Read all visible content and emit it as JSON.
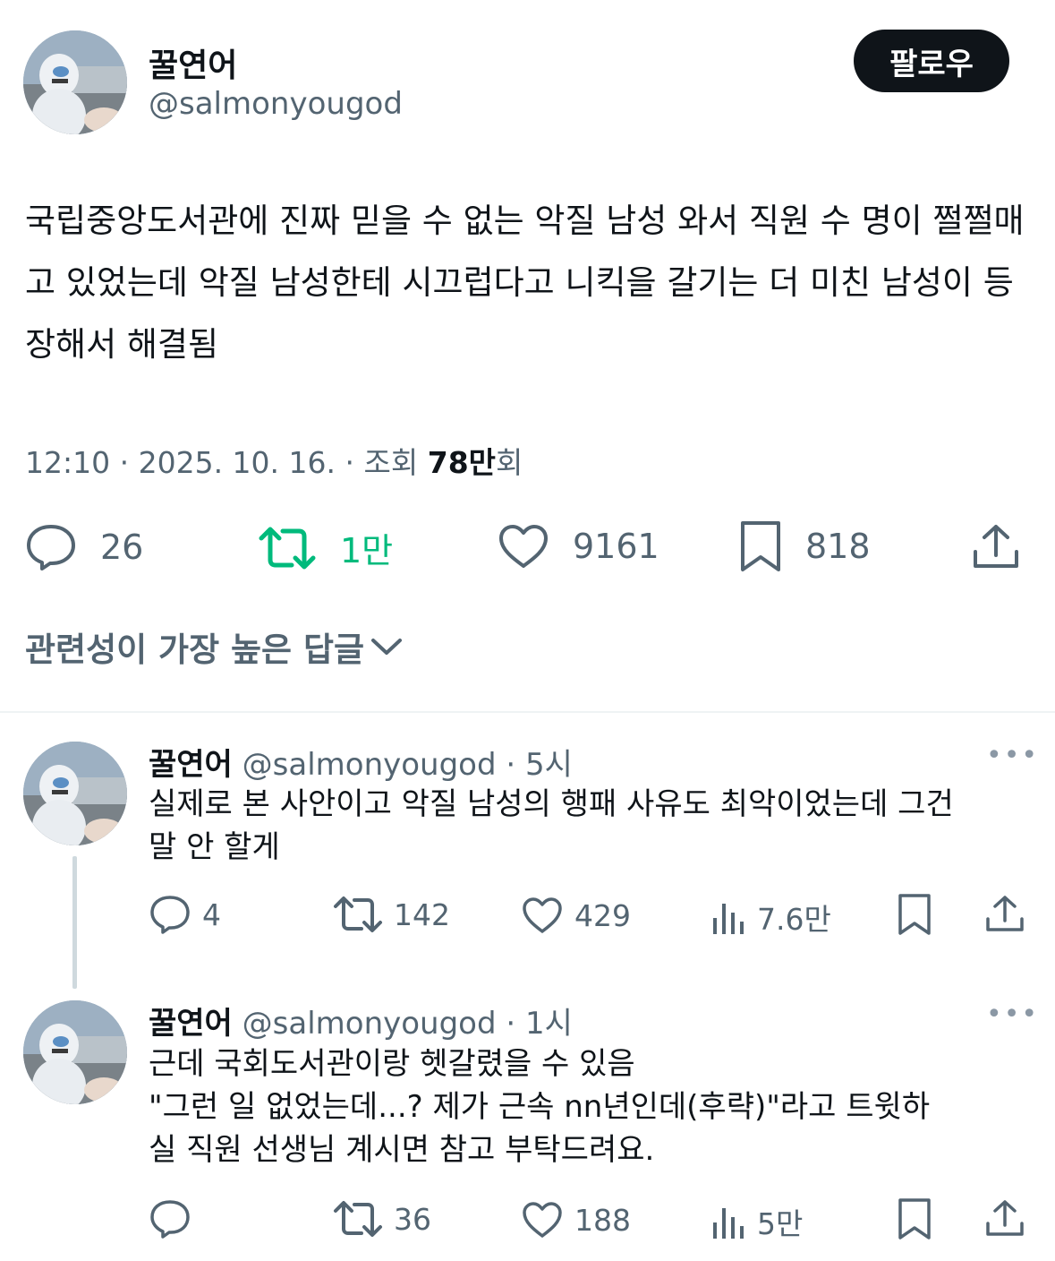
{
  "tweet": {
    "author_name": "꿀연어",
    "author_handle": "@salmonyougod",
    "follow_label": "팔로우",
    "text": "국립중앙도서관에 진짜 믿을 수 없는 악질 남성 와서 직원 수 명이 쩔쩔매고 있었는데 악질 남성한테 시끄럽다고 니킥을 갈기는 더 미친 남성이 등장해서 해결됨",
    "time": "12:10",
    "date": "2025. 10. 16.",
    "views_label": "조회",
    "views_count": "78만",
    "views_suffix": "회",
    "stats": {
      "replies": "26",
      "retweets": "1만",
      "likes": "9161",
      "bookmarks": "818"
    },
    "colors": {
      "retweet_active": "#00ba7c",
      "text": "#0f1419",
      "muted": "#536471"
    }
  },
  "replies_filter": {
    "label": "관련성이 가장 높은 답글",
    "icon": "chevron-down-icon"
  },
  "replies": [
    {
      "author_name": "꿀연어",
      "author_handle": "@salmonyougod",
      "time": "· 5시",
      "text_lines": [
        "실제로 본 사안이고 악질 남성의 행패 사유도 최악이었는데 그건",
        "말 안 할게"
      ],
      "stats": {
        "replies": "4",
        "retweets": "142",
        "likes": "429",
        "views": "7.6만"
      }
    },
    {
      "author_name": "꿀연어",
      "author_handle": "@salmonyougod",
      "time": "· 1시",
      "text_lines": [
        "근데 국회도서관이랑 헷갈렸을 수 있음",
        "\"그런 일 없었는데...? 제가 근속 nn년인데(후략)\"라고 트윗하",
        "실 직원 선생님 계시면 참고 부탁드려요."
      ],
      "stats": {
        "replies": "",
        "retweets": "36",
        "likes": "188",
        "views": "5만"
      }
    }
  ]
}
